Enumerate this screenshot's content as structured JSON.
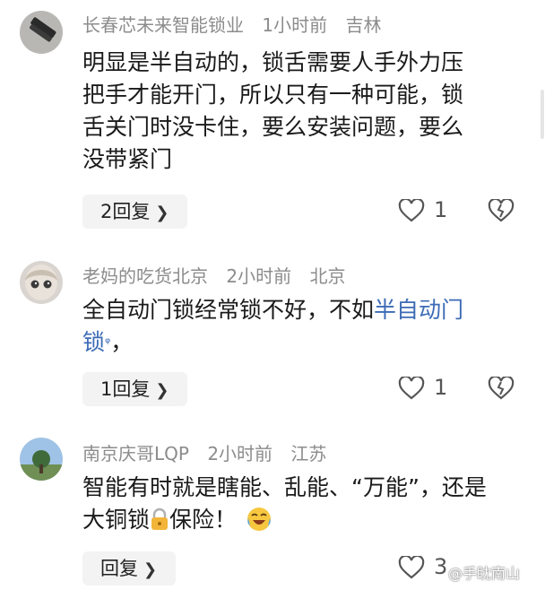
{
  "comments": [
    {
      "author": "长春芯未来智能锁业",
      "time": "1小时前",
      "location": "吉林",
      "text_lines": [
        "明显是半自动的，锁舌需要人手外力压",
        "把手才能开门，所以只有一种可能，锁",
        "舌关门时没卡住，要么安装问题，要么",
        "没带紧门"
      ],
      "reply_label": "2回复",
      "likes": "1"
    },
    {
      "author": "老妈的吃货北京",
      "time": "2小时前",
      "location": "北京",
      "text_before_link": "全自动门锁经常锁不好，不如",
      "link_text_1": "半自动门",
      "link_text_2": "锁",
      "text_after_link": "，",
      "reply_label": "1回复",
      "likes": "1"
    },
    {
      "author": "南京庆哥LQP",
      "time": "2小时前",
      "location": "江苏",
      "text_line1": "智能有时就是瞎能、乱能、“万能”，还是",
      "text_line2_a": "大铜锁",
      "text_line2_b": "保险！",
      "reply_label": "回复",
      "likes": "3"
    }
  ],
  "watermark": "@手眈南山",
  "icons": {
    "like": "heart-outline-icon",
    "dislike": "broken-heart-icon",
    "chevron": "chevron-right-icon",
    "search": "search-icon",
    "lock": "lock-emoji-icon",
    "laugh": "laughing-crying-emoji-icon"
  },
  "colors": {
    "link": "#3c6bb5",
    "meta": "#8c8c8c",
    "text": "#1a1a1a"
  }
}
